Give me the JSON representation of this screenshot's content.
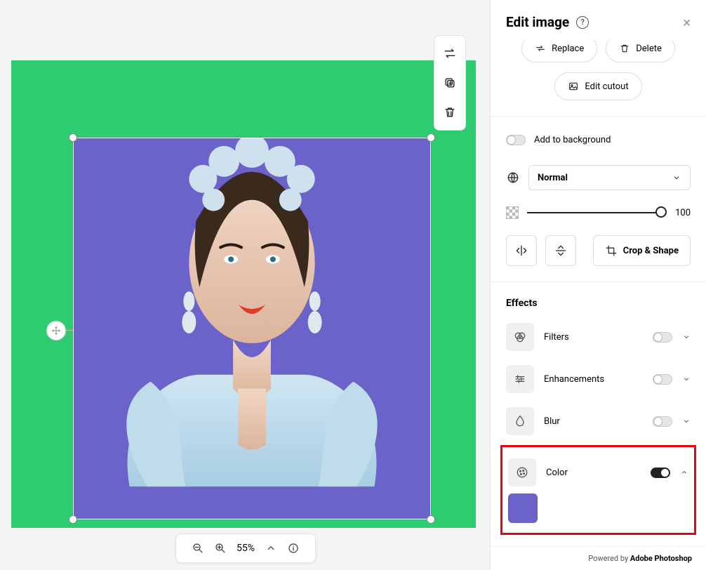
{
  "panel": {
    "title": "Edit image",
    "actions": {
      "replace": "Replace",
      "delete": "Delete",
      "edit_cutout": "Edit cutout"
    },
    "add_to_background": "Add to background",
    "blend_mode": "Normal",
    "opacity": "100",
    "crop_shape": "Crop & Shape",
    "effects_heading": "Effects",
    "effects": {
      "filters": "Filters",
      "enhancements": "Enhancements",
      "blur": "Blur",
      "color": "Color"
    },
    "color_swatch": "#6b63c9",
    "footer_prefix": "Powered by ",
    "footer_brand": "Adobe Photoshop"
  },
  "zoom": {
    "percent": "55%"
  },
  "canvas": {
    "bg_color": "#2ecc71",
    "selection_bg": "#6b63c9"
  }
}
